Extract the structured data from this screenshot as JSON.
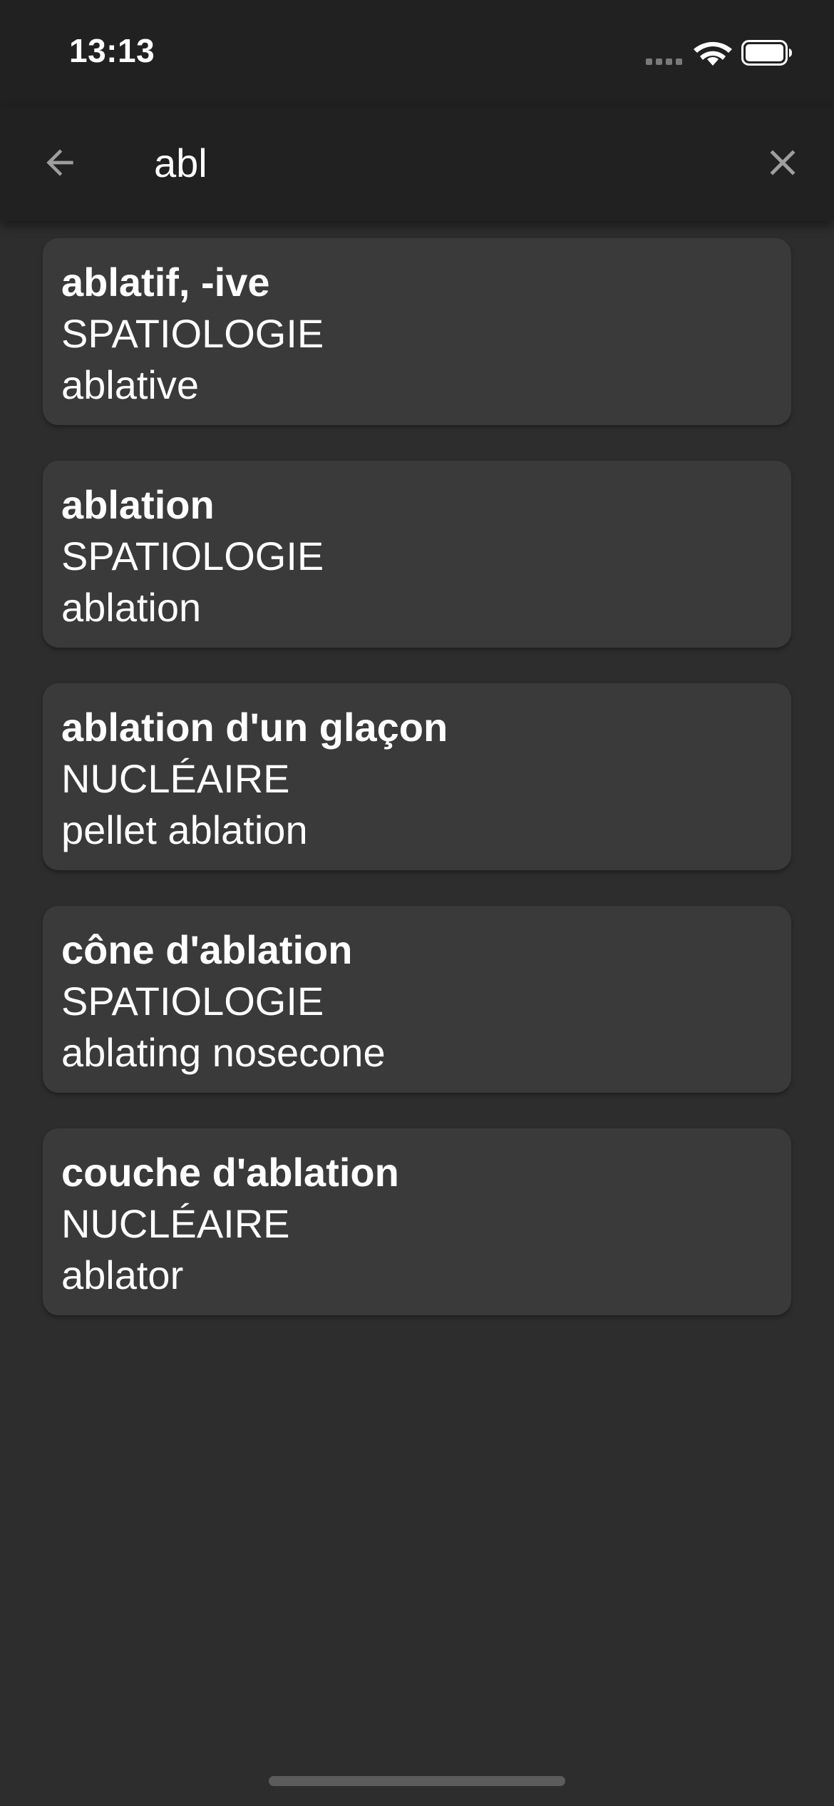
{
  "status_bar": {
    "time": "13:13",
    "icons": [
      "cellular-signal-icon",
      "wifi-icon",
      "battery-icon"
    ]
  },
  "search": {
    "query": "abl",
    "back_icon": "arrow-left-icon",
    "clear_icon": "close-icon"
  },
  "results": [
    {
      "term": "ablatif, -ive",
      "domain": "SPATIOLOGIE",
      "translation": "ablative"
    },
    {
      "term": "ablation",
      "domain": "SPATIOLOGIE",
      "translation": "ablation"
    },
    {
      "term": "ablation d'un glaçon",
      "domain": "NUCLÉAIRE",
      "translation": "pellet ablation"
    },
    {
      "term": "cône d'ablation",
      "domain": "SPATIOLOGIE",
      "translation": "ablating nosecone"
    },
    {
      "term": "couche d'ablation",
      "domain": "NUCLÉAIRE",
      "translation": "ablator"
    }
  ],
  "colors": {
    "background": "#2d2d2d",
    "bars": "#212121",
    "card": "#3a3a3a",
    "text": "#ffffff",
    "icon": "#9e9e9e"
  }
}
